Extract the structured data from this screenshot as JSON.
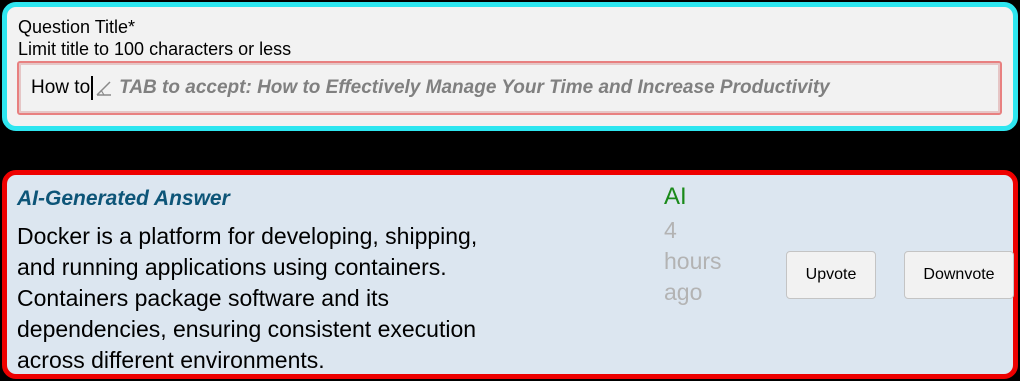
{
  "question": {
    "label": "Question Title*",
    "hint": "Limit title to 100 characters or less",
    "input_value": "How to",
    "suggestion_icon": "autocomplete-icon",
    "suggestion_text": "TAB to accept: How to Effectively Manage Your Time and Increase Productivity"
  },
  "answer": {
    "title": "AI-Generated Answer",
    "body_lines": [
      "Docker is a platform for developing, shipping,",
      "and running applications using containers.",
      "Containers package software and its",
      "dependencies, ensuring consistent execution",
      "across different environments."
    ],
    "author": "AI",
    "time_lines": [
      "4",
      "hours",
      "ago"
    ],
    "upvote_label": "Upvote",
    "downvote_label": "Downvote"
  },
  "colors": {
    "question_border": "#2ee6f0",
    "answer_border": "#ee0000",
    "answer_bg": "#dce6f0",
    "title_color": "#0d5578",
    "author_color": "#1a8a1a"
  }
}
